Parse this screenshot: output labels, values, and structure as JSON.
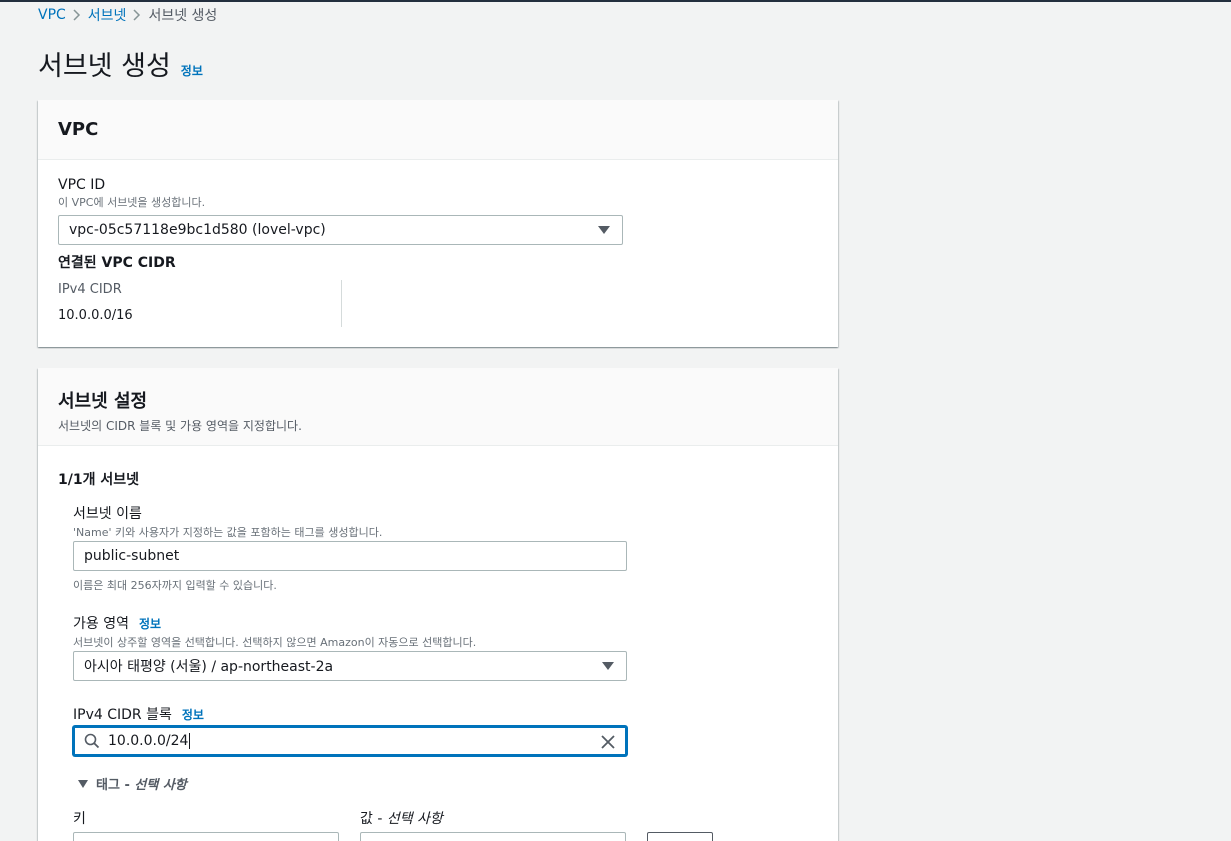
{
  "breadcrumb": {
    "items": [
      "VPC",
      "서브넷",
      "서브넷 생성"
    ]
  },
  "page": {
    "title": "서브넷 생성",
    "info_label": "정보"
  },
  "vpc_panel": {
    "title": "VPC",
    "vpc_id_label": "VPC ID",
    "vpc_id_sublabel": "이 VPC에 서브넷을 생성합니다.",
    "vpc_id_value": "vpc-05c57118e9bc1d580 (lovel-vpc)",
    "cidr_section_title": "연결된 VPC CIDR",
    "ipv4_cidr_label": "IPv4 CIDR",
    "ipv4_cidr_value": "10.0.0.0/16"
  },
  "subnet_panel": {
    "title": "서브넷 설정",
    "description": "서브넷의 CIDR 블록 및 가용 영역을 지정합니다.",
    "count_label": "1/1개 서브넷",
    "name_label": "서브넷 이름",
    "name_sublabel": "'Name' 키와 사용자가 지정하는 값을 포함하는 태그를 생성합니다.",
    "name_value": "public-subnet",
    "name_hint": "이름은 최대 256자까지 입력할 수 있습니다.",
    "az_label": "가용 영역",
    "az_info": "정보",
    "az_sublabel": "서브넷이 상주할 영역을 선택합니다. 선택하지 않으면 Amazon이 자동으로 선택합니다.",
    "az_value": "아시아 태평양 (서울) / ap-northeast-2a",
    "cidr_label": "IPv4 CIDR 블록",
    "cidr_info": "정보",
    "cidr_value": "10.0.0.0/24",
    "tags_toggle": "태그 - ",
    "tags_optional": "선택 사항",
    "key_label": "키",
    "value_label": "값 - ",
    "value_optional": "선택 사항"
  },
  "colors": {
    "link": "#0073bb",
    "background": "#f2f3f3",
    "focus": "#0073bb"
  },
  "icons": [
    "chevron-right-icon",
    "caret-down-icon",
    "search-icon",
    "close-icon",
    "triangle-down-icon"
  ]
}
